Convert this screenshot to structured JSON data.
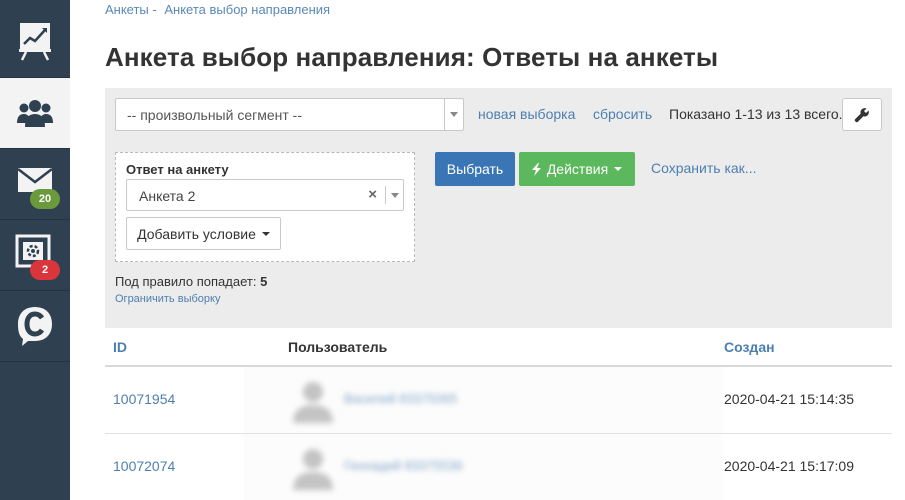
{
  "sidebar": {
    "items": [
      {
        "icon": "presentation-chart-icon"
      },
      {
        "icon": "users-group-icon",
        "active": true
      },
      {
        "icon": "mail-icon",
        "badge": "20",
        "badge_color": "#6b9a3c"
      },
      {
        "icon": "settings-panel-icon",
        "badge": "2",
        "badge_color": "#d9353a"
      },
      {
        "icon": "chat-c-icon"
      }
    ]
  },
  "breadcrumb": {
    "item1": "Анкеты",
    "separator": "-",
    "item2": "Анкета выбор направления"
  },
  "page_title": "Анкета выбор направления: Ответы на анкеты",
  "toolbar": {
    "segment_value": "-- произвольный сегмент --",
    "new_selection": "новая выборка",
    "reset": "сбросить",
    "shown": "Показано 1-13 из 13 всего."
  },
  "condition": {
    "title": "Ответ на анкету",
    "value": "Анкета 2",
    "clear_symbol": "×",
    "add_label": "Добавить условие"
  },
  "actions": {
    "select_label": "Выбрать",
    "actions_label": "Действия",
    "save_as_label": "Сохранить как..."
  },
  "rule": {
    "text": "Под правило попадает:",
    "count": "5",
    "limit_link": "Ограничить выборку"
  },
  "table": {
    "columns": [
      "ID",
      "Пользователь",
      "Создан"
    ],
    "rows": [
      {
        "id": "10071954",
        "user": "Василий 83375065",
        "created": "2020-04-21 15:14:35"
      },
      {
        "id": "10072074",
        "user": "Геннадий 83375536",
        "created": "2020-04-21 15:17:09"
      }
    ]
  },
  "colors": {
    "sidebar_bg": "#2f4050",
    "link": "#4d7fb0",
    "primary_button": "#3a76b5",
    "success_button": "#5cb85c"
  }
}
